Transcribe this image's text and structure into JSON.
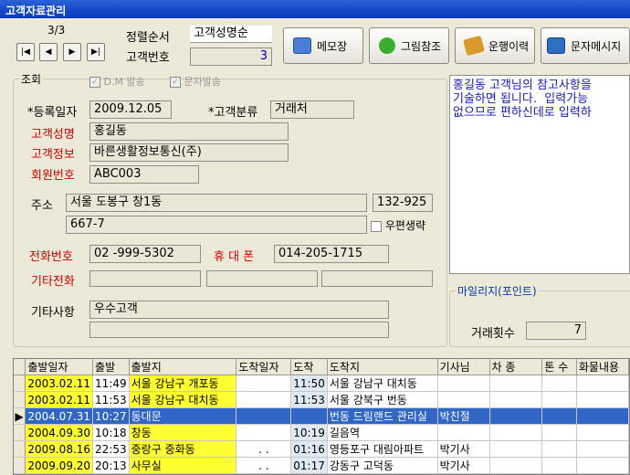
{
  "window": {
    "title": "고객자료관리"
  },
  "nav": {
    "counter": "3/3",
    "first": "|◀",
    "prev": "◀",
    "next": "▶",
    "last": "▶|"
  },
  "sort": {
    "label": "정렬순서",
    "value": "고객성명순"
  },
  "custno": {
    "label": "고객번호",
    "value": "3"
  },
  "toolbar": {
    "memo": "메모장",
    "picture": "그림참조",
    "history": "운행이력",
    "sms": "문자메시지"
  },
  "search": {
    "legend": "조회",
    "dm": "D.M 발송",
    "sms": "문자발송"
  },
  "form": {
    "regdate_label": "*등록일자",
    "regdate": "2009.12.05",
    "category_label": "*고객분류",
    "category": "거래처",
    "name_label": "고객성명",
    "name": "홍길동",
    "info_label": "고객정보",
    "info": "바른생활정보통신(주)",
    "member_label": "회원번호",
    "member": "ABC003",
    "addr_label": "주소",
    "addr1": "서울 도봉구 창1동",
    "zip": "132-925",
    "addr2": "667-7",
    "mail_label": "우편생략",
    "phone_label": "전화번호",
    "phone": "02  -999-5302",
    "mobile_label": "휴 대 폰",
    "mobile": "014-205-1715",
    "other_phone_label": "기타전화",
    "etc_label": "기타사항",
    "etc": "우수고객"
  },
  "memo_text": "홍길동 고객님의 참고사항을\n기술하면 됩니다.  입력가능\n없으므로 편하신데로 입력하",
  "mileage": {
    "legend": "마일리지(포인트)",
    "count_label": "거래횟수",
    "count": "7"
  },
  "grid": {
    "columns": [
      "출발일자",
      "출발",
      "출발지",
      "도착일자",
      "도착",
      "도착지",
      "기사님",
      "차 종",
      "톤 수",
      "화물내용"
    ],
    "rows": [
      [
        "2003.02.11",
        "11:49",
        "서울 강남구 개포동",
        "",
        "11:50",
        "서울 강남구 대치동",
        "",
        "",
        "",
        ""
      ],
      [
        "2003.02.11",
        "11:53",
        "서울 강남구 대치동",
        "",
        "11:53",
        "서울 강북구 번동",
        "",
        "",
        "",
        ""
      ],
      [
        "2004.07.31",
        "10:27",
        "동대문",
        "",
        "",
        "번동 드림랜드 관리실",
        "박친절",
        "",
        "",
        ""
      ],
      [
        "2004.09.30",
        "10:18",
        "창동",
        "",
        "10:19",
        "길음역",
        "",
        "",
        "",
        ""
      ],
      [
        "2009.08.16",
        "22:53",
        "중랑구 중화동",
        ". .",
        "01:16",
        "영등포구 대림아파트",
        "박기사",
        "",
        "",
        ""
      ],
      [
        "2009.09.20",
        "20:13",
        "사무실",
        ". .",
        "01:17",
        "강동구 고덕동",
        "박기사",
        "",
        "",
        ""
      ]
    ]
  }
}
